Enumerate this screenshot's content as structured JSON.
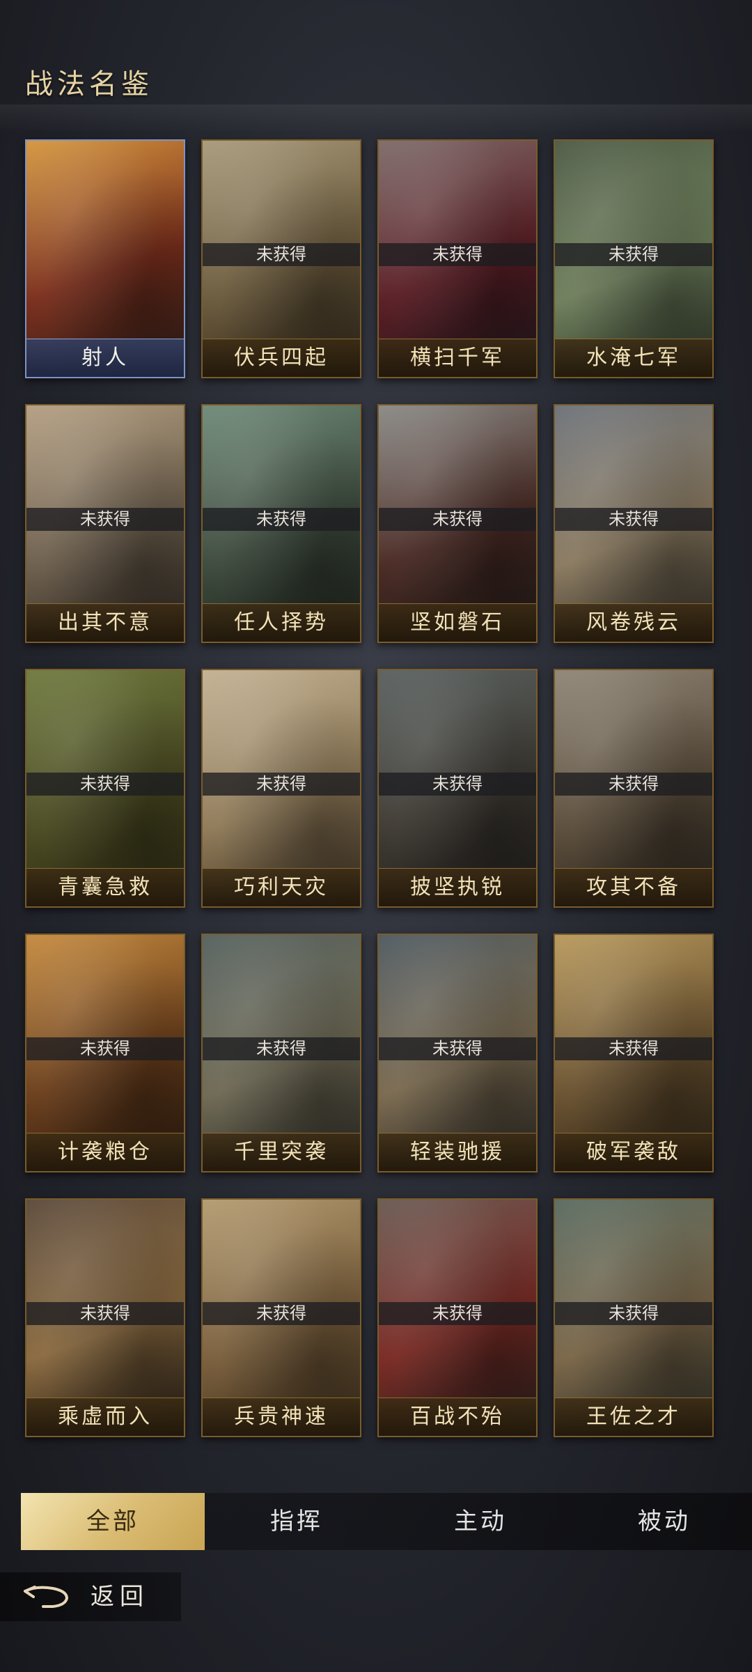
{
  "page": {
    "title": "战法名鉴"
  },
  "cards": [
    {
      "name": "射人",
      "status": "",
      "selected": true,
      "colors": [
        "#d5963e",
        "#7a2e1c",
        "#2a1f1a"
      ]
    },
    {
      "name": "伏兵四起",
      "status": "未获得",
      "selected": false,
      "colors": [
        "#a89a7a",
        "#6b5a3c",
        "#2e261b"
      ]
    },
    {
      "name": "横扫千军",
      "status": "未获得",
      "selected": false,
      "colors": [
        "#7e6b6a",
        "#5a1d24",
        "#1e1a1f"
      ]
    },
    {
      "name": "水淹七军",
      "status": "未获得",
      "selected": false,
      "colors": [
        "#4d5a44",
        "#6f7f5c",
        "#2a3226"
      ]
    },
    {
      "name": "出其不意",
      "status": "未获得",
      "selected": false,
      "colors": [
        "#b49f82",
        "#6d5f4d",
        "#2b2621"
      ]
    },
    {
      "name": "任人择势",
      "status": "未获得",
      "selected": false,
      "colors": [
        "#6f8a78",
        "#3d4a3d",
        "#1e221c"
      ]
    },
    {
      "name": "坚如磐石",
      "status": "未获得",
      "selected": false,
      "colors": [
        "#8a8a86",
        "#4a2a24",
        "#1f1b19"
      ]
    },
    {
      "name": "风卷残云",
      "status": "未获得",
      "selected": false,
      "colors": [
        "#6d7279",
        "#8a7a60",
        "#2d2a24"
      ]
    },
    {
      "name": "青囊急救",
      "status": "未获得",
      "selected": false,
      "colors": [
        "#6f7a3e",
        "#4a4a22",
        "#2b2812"
      ]
    },
    {
      "name": "巧利天灾",
      "status": "未获得",
      "selected": false,
      "colors": [
        "#c2b192",
        "#8f7a58",
        "#3a2f22"
      ]
    },
    {
      "name": "披坚执锐",
      "status": "未获得",
      "selected": false,
      "colors": [
        "#5a6160",
        "#3e3a33",
        "#1f1c1a"
      ]
    },
    {
      "name": "攻其不备",
      "status": "未获得",
      "selected": false,
      "colors": [
        "#8f8677",
        "#5b4d3b",
        "#26211c"
      ]
    },
    {
      "name": "计袭粮仓",
      "status": "未获得",
      "selected": false,
      "colors": [
        "#c58a3e",
        "#6b3f1c",
        "#2a1a10"
      ]
    },
    {
      "name": "千里突袭",
      "status": "未获得",
      "selected": false,
      "colors": [
        "#56615e",
        "#6f6a55",
        "#2a2924"
      ]
    },
    {
      "name": "轻装驰援",
      "status": "未获得",
      "selected": false,
      "colors": [
        "#4f5a60",
        "#7a6a50",
        "#272522"
      ]
    },
    {
      "name": "破军袭敌",
      "status": "未获得",
      "selected": false,
      "colors": [
        "#b8995c",
        "#6a5230",
        "#2a2216"
      ]
    },
    {
      "name": "乘虚而入",
      "status": "未获得",
      "selected": false,
      "colors": [
        "#5c4a3a",
        "#8a6a40",
        "#1e1812"
      ]
    },
    {
      "name": "兵贵神速",
      "status": "未获得",
      "selected": false,
      "colors": [
        "#b39a70",
        "#7a5f3c",
        "#3a2c1c"
      ]
    },
    {
      "name": "百战不殆",
      "status": "未获得",
      "selected": false,
      "colors": [
        "#6a5a52",
        "#7a2a24",
        "#22201d"
      ]
    },
    {
      "name": "王佐之才",
      "status": "未获得",
      "selected": false,
      "colors": [
        "#5a6b60",
        "#7a6648",
        "#2a2c26"
      ]
    }
  ],
  "tabs": [
    {
      "label": "全部",
      "active": true
    },
    {
      "label": "指挥",
      "active": false
    },
    {
      "label": "主动",
      "active": false
    },
    {
      "label": "被动",
      "active": false
    }
  ],
  "back": {
    "label": "返回",
    "icon": "back-arrow-icon"
  },
  "colors": {
    "accent_gold": "#d9bb72",
    "frame_gold": "#7a5c2b",
    "selected_frame": "#7f93c4"
  }
}
